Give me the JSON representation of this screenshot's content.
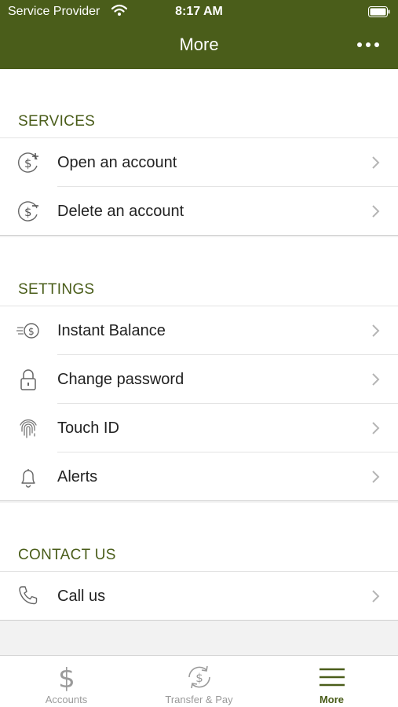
{
  "status_bar": {
    "carrier": "Service Provider",
    "time": "8:17 AM"
  },
  "header": {
    "title": "More"
  },
  "sections": {
    "services": {
      "title": "SERVICES",
      "items": [
        {
          "label": "Open an account",
          "icon": "dollar-plus-icon"
        },
        {
          "label": "Delete an account",
          "icon": "dollar-minus-icon"
        }
      ]
    },
    "settings": {
      "title": "SETTINGS",
      "items": [
        {
          "label": "Instant Balance",
          "icon": "instant-balance-icon"
        },
        {
          "label": "Change password",
          "icon": "lock-icon"
        },
        {
          "label": "Touch ID",
          "icon": "fingerprint-icon"
        },
        {
          "label": "Alerts",
          "icon": "bell-icon"
        }
      ]
    },
    "contact": {
      "title": "CONTACT US",
      "items": [
        {
          "label": "Call us",
          "icon": "phone-icon"
        }
      ]
    }
  },
  "tabbar": {
    "tabs": [
      {
        "label": "Accounts",
        "icon": "dollar-icon",
        "active": false
      },
      {
        "label": "Transfer & Pay",
        "icon": "transfer-icon",
        "active": false
      },
      {
        "label": "More",
        "icon": "menu-icon",
        "active": true
      }
    ]
  },
  "colors": {
    "brand": "#4a5d1a",
    "inactive": "#9a9a9a",
    "background": "#f2f2f2"
  }
}
